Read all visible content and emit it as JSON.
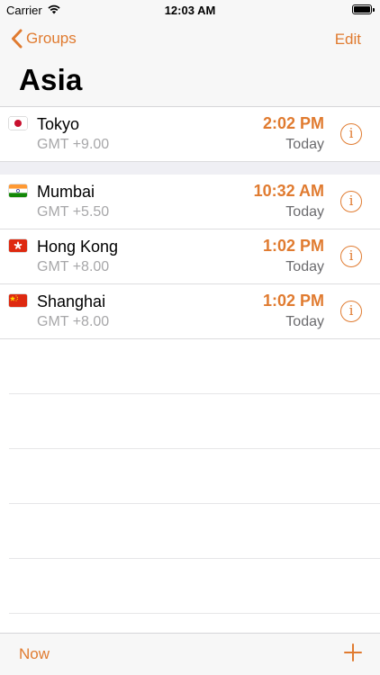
{
  "status_bar": {
    "carrier": "Carrier",
    "time": "12:03 AM"
  },
  "nav": {
    "back_label": "Groups",
    "edit_label": "Edit",
    "title": "Asia"
  },
  "accent_color": "#e07b30",
  "sections": [
    {
      "rows": [
        {
          "city": "Tokyo",
          "gmt": "GMT +9.00",
          "time": "2:02 PM",
          "day": "Today",
          "flag": "japan-flag-icon"
        }
      ]
    },
    {
      "rows": [
        {
          "city": "Mumbai",
          "gmt": "GMT +5.50",
          "time": "10:32 AM",
          "day": "Today",
          "flag": "india-flag-icon"
        },
        {
          "city": "Hong Kong",
          "gmt": "GMT +8.00",
          "time": "1:02 PM",
          "day": "Today",
          "flag": "hong-kong-flag-icon"
        },
        {
          "city": "Shanghai",
          "gmt": "GMT +8.00",
          "time": "1:02 PM",
          "day": "Today",
          "flag": "china-flag-icon"
        }
      ]
    }
  ],
  "info_glyph": "i",
  "toolbar": {
    "now_label": "Now"
  }
}
